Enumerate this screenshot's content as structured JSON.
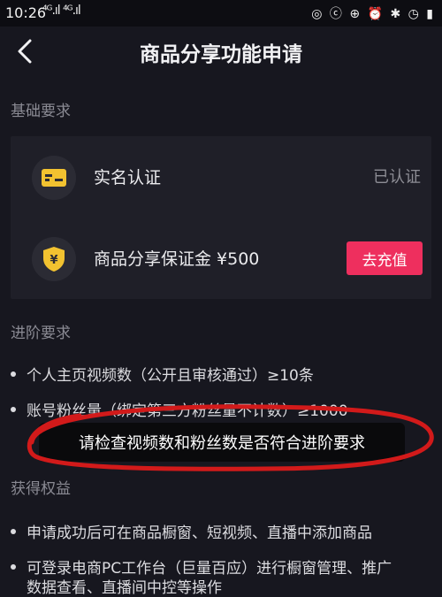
{
  "status_bar": {
    "time": "10:26",
    "signal": "⁴ᴳ.ıl ⁴ᴳ.ıl",
    "right_icons": "◎ ⓒ ⊕ ⏰ ✱ ◷ ▮"
  },
  "header": {
    "title": "商品分享功能申请"
  },
  "basic": {
    "label": "基础要求",
    "realname": {
      "label": "实名认证",
      "status": "已认证"
    },
    "deposit": {
      "label": "商品分享保证金 ¥500",
      "button": "去充值"
    }
  },
  "advanced": {
    "label": "进阶要求",
    "items": [
      "个人主页视频数（公开且审核通过）≥10条",
      "账号粉丝量（绑定第三方粉丝量不计数）≥1000"
    ]
  },
  "toast": "请检查视频数和粉丝数是否符合进阶要求",
  "benefits": {
    "label": "获得权益",
    "items": [
      "申请成功后可在商品橱窗、短视频、直播中添加商品",
      "可登录电商PC工作台（巨量百应）进行橱窗管理、推广",
      "数据查看、直播间中控等操作"
    ]
  },
  "colors": {
    "accent": "#ee2f5e",
    "background": "#17171f",
    "card": "#1f1f28",
    "shield": "#f2c230"
  }
}
